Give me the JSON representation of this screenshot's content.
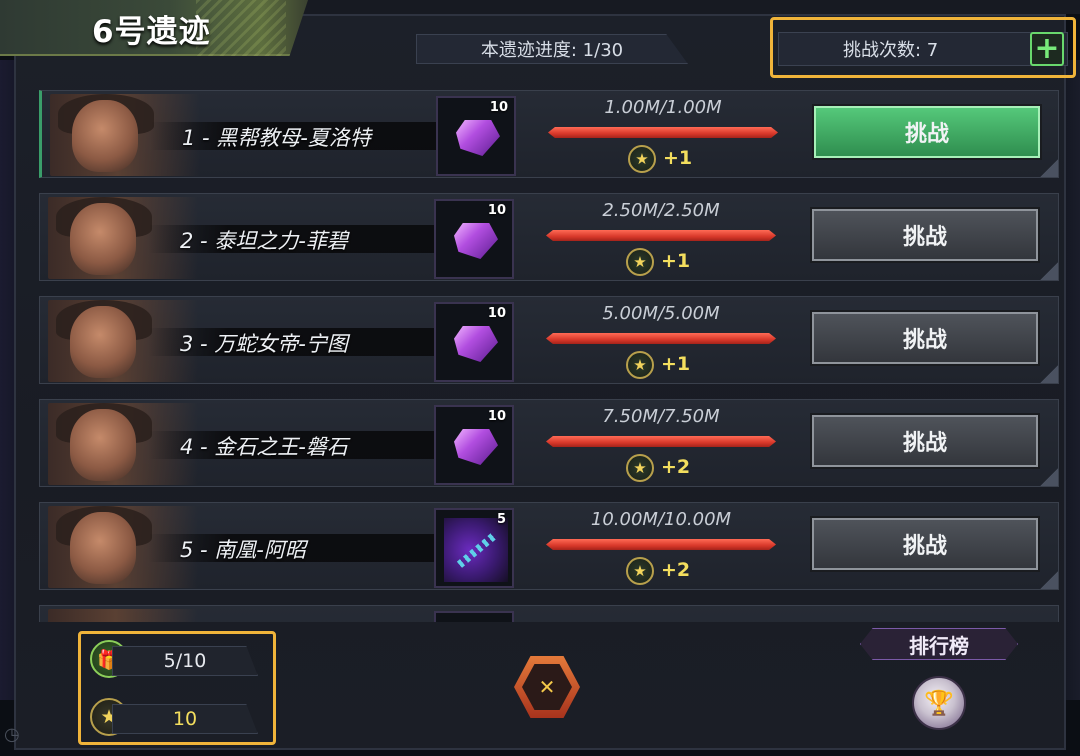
{
  "header": {
    "title": "6号遗迹",
    "progress": "本遗迹进度: 1/30",
    "challenges": "挑战次数: 7",
    "plus_symbol": "+"
  },
  "rows": [
    {
      "name": "1 - 黑帮教母-夏洛特",
      "item_count": "10",
      "item_type": "purple-gem",
      "hp": "1.00M/1.00M",
      "hp_fraction": 1.0,
      "bonus": "+1",
      "button": "挑战",
      "active": true
    },
    {
      "name": "2 - 泰坦之力-菲碧",
      "item_count": "10",
      "item_type": "purple-gem",
      "hp": "2.50M/2.50M",
      "hp_fraction": 1.0,
      "bonus": "+1",
      "button": "挑战",
      "active": false
    },
    {
      "name": "3 - 万蛇女帝-宁图",
      "item_count": "10",
      "item_type": "purple-gem",
      "hp": "5.00M/5.00M",
      "hp_fraction": 1.0,
      "bonus": "+1",
      "button": "挑战",
      "active": false
    },
    {
      "name": "4 - 金石之王-磐石",
      "item_count": "10",
      "item_type": "purple-gem",
      "hp": "7.50M/7.50M",
      "hp_fraction": 1.0,
      "bonus": "+2",
      "button": "挑战",
      "active": false
    },
    {
      "name": "5 - 南凰-阿昭",
      "item_count": "5",
      "item_type": "dna-helix",
      "hp": "10.00M/10.00M",
      "hp_fraction": 1.0,
      "bonus": "+2",
      "button": "挑战",
      "active": false
    }
  ],
  "footer": {
    "gift_progress": "5/10",
    "medal_count": "10",
    "rank_label": "排行榜"
  },
  "icons": {
    "gift": "gift-icon",
    "medal": "medal-icon",
    "trophy": "trophy-icon",
    "center": "battle-emblem-icon",
    "plus": "plus-icon"
  },
  "colors": {
    "accent_green": "#55c87a",
    "highlight_orange": "#f0b43a",
    "hp_red": "#d8382a",
    "bonus_yellow": "#f3de5e"
  }
}
